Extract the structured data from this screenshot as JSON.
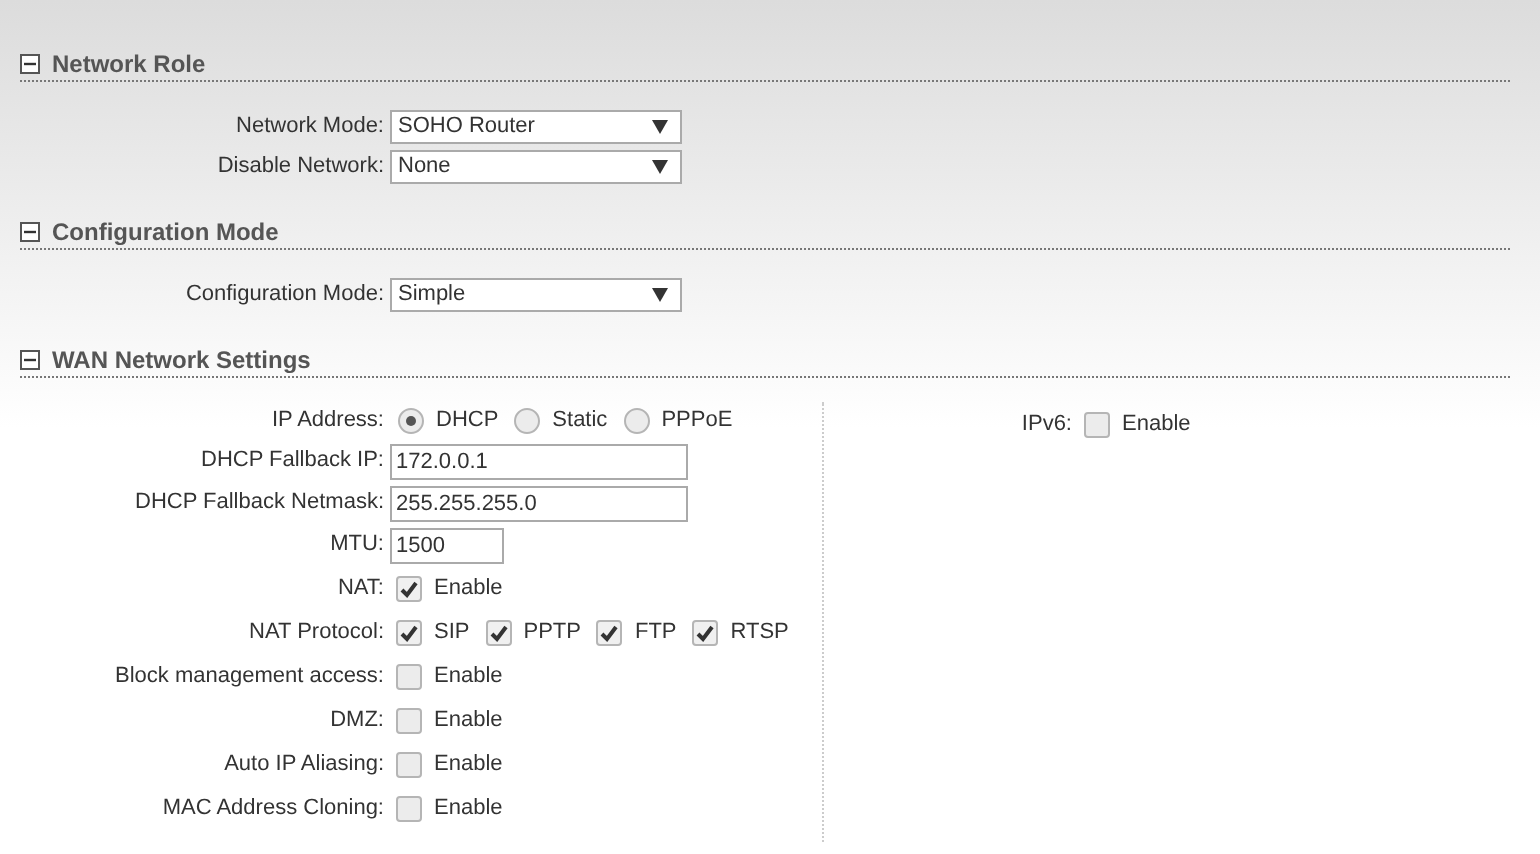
{
  "sections": [
    {
      "title": "Network Role",
      "expanded": true,
      "rows": [
        {
          "kind": "select",
          "label": "Network Mode:",
          "value": "SOHO Router"
        },
        {
          "kind": "select",
          "label": "Disable Network:",
          "value": "None"
        }
      ]
    },
    {
      "title": "Configuration Mode",
      "expanded": true,
      "rows": [
        {
          "kind": "select",
          "label": "Configuration Mode:",
          "value": "Simple"
        }
      ]
    },
    {
      "title": "WAN Network Settings",
      "expanded": true,
      "rows": [
        {
          "kind": "radio",
          "label": "IP Address:",
          "options": [
            {
              "label": "DHCP",
              "selected": true
            },
            {
              "label": "Static",
              "selected": false
            },
            {
              "label": "PPPoE",
              "selected": false
            }
          ]
        },
        {
          "kind": "text",
          "label": "DHCP Fallback IP:",
          "value": "172.0.0.1"
        },
        {
          "kind": "text",
          "label": "DHCP Fallback Netmask:",
          "value": "255.255.255.0"
        },
        {
          "kind": "number",
          "label": "MTU:",
          "value": "1500"
        },
        {
          "kind": "checks",
          "label": "NAT:",
          "options": [
            {
              "label": "Enable",
              "checked": true
            }
          ]
        },
        {
          "kind": "checks",
          "label": "NAT Protocol:",
          "options": [
            {
              "label": "SIP",
              "checked": true
            },
            {
              "label": "PPTP",
              "checked": true
            },
            {
              "label": "FTP",
              "checked": true
            },
            {
              "label": "RTSP",
              "checked": true
            }
          ]
        },
        {
          "kind": "checks",
          "label": "Block management access:",
          "options": [
            {
              "label": "Enable",
              "checked": false
            }
          ]
        },
        {
          "kind": "checks",
          "label": "DMZ:",
          "options": [
            {
              "label": "Enable",
              "checked": false
            }
          ]
        },
        {
          "kind": "checks",
          "label": "Auto IP Aliasing:",
          "options": [
            {
              "label": "Enable",
              "checked": false
            }
          ]
        },
        {
          "kind": "checks",
          "label": "MAC Address Cloning:",
          "options": [
            {
              "label": "Enable",
              "checked": false
            }
          ]
        }
      ],
      "side_rows": [
        {
          "kind": "checks",
          "label": "IPv6:",
          "options": [
            {
              "label": "Enable",
              "checked": false
            }
          ]
        }
      ]
    }
  ]
}
